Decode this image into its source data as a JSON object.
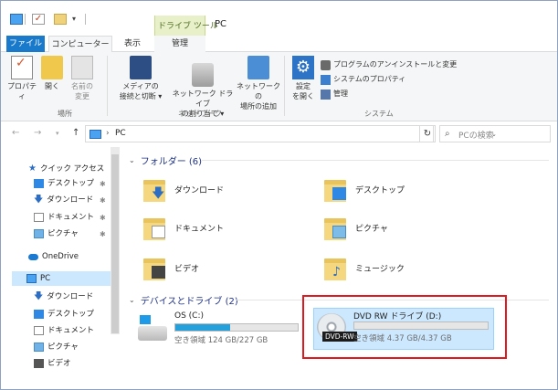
{
  "qat": {
    "dropdown": "▾"
  },
  "contextual_tab_group": "ドライブ ツール",
  "window_title": "PC",
  "tabs": {
    "file": "ファイル",
    "computer": "コンピューター",
    "view": "表示",
    "manage": "管理"
  },
  "ribbon": {
    "properties": "プロパティ",
    "open": "開く",
    "rename": [
      "名前の",
      "変更"
    ],
    "media": [
      "メディアの",
      "接続と切断 ▾"
    ],
    "map_drive": [
      "ネットワーク ドライブ",
      "の割り当て ▾"
    ],
    "add_location": [
      "ネットワークの",
      "場所の追加"
    ],
    "settings": [
      "設定",
      "を開く"
    ],
    "uninstall": "プログラムのアンインストールと変更",
    "system_properties": "システムのプロパティ",
    "manage": "管理",
    "group_location": "場所",
    "group_network": "ネットワーク",
    "group_system": "システム"
  },
  "addressbar": {
    "back": "←",
    "forward": "→",
    "recent": "▾",
    "up": "↑",
    "separator": "›",
    "path": "PC",
    "dropdown": "⌄",
    "refresh": "↻",
    "search_placeholder": "PCの検索"
  },
  "navpane": {
    "quick_access": "クイック アクセス",
    "qa_items": [
      "デスクトップ",
      "ダウンロード",
      "ドキュメント",
      "ピクチャ"
    ],
    "onedrive": "OneDrive",
    "pc": "PC",
    "pc_items": [
      "ダウンロード",
      "デスクトップ",
      "ドキュメント",
      "ピクチャ",
      "ビデオ"
    ]
  },
  "content": {
    "folders_header": "フォルダー (6)",
    "folders": [
      "ダウンロード",
      "デスクトップ",
      "ドキュメント",
      "ピクチャ",
      "ビデオ",
      "ミュージック"
    ],
    "devices_header": "デバイスとドライブ (2)",
    "drives": [
      {
        "name": "OS (C:)",
        "free": "空き領域 124 GB/227 GB",
        "used_fraction": 0.45
      },
      {
        "name": "DVD RW ドライブ (D:)",
        "free": "空き領域 4.37 GB/4.37 GB",
        "used_fraction": 0.0,
        "badge": "DVD-RW"
      }
    ]
  },
  "colors": {
    "accent": "#1979ca",
    "highlight_frame": "#e0181f",
    "selection": "#cce8ff"
  }
}
